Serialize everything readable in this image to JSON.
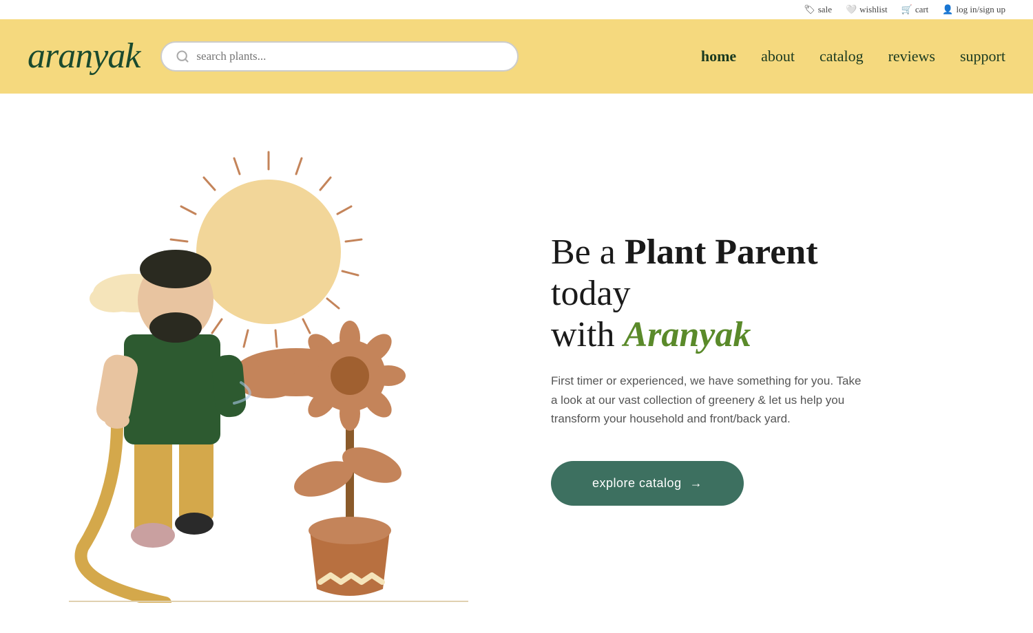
{
  "topbar": {
    "items": [
      {
        "id": "sale",
        "label": "sale",
        "icon": "tag"
      },
      {
        "id": "wishlist",
        "label": "wishlist",
        "icon": "heart"
      },
      {
        "id": "cart",
        "label": "cart",
        "icon": "cart"
      },
      {
        "id": "login",
        "label": "log in/sign up",
        "icon": "user"
      }
    ]
  },
  "header": {
    "logo": "aranyak",
    "search_placeholder": "search plants...",
    "nav": [
      {
        "id": "home",
        "label": "home",
        "active": true
      },
      {
        "id": "about",
        "label": "about",
        "active": false
      },
      {
        "id": "catalog",
        "label": "catalog",
        "active": false
      },
      {
        "id": "reviews",
        "label": "reviews",
        "active": false
      },
      {
        "id": "support",
        "label": "support",
        "active": false
      }
    ]
  },
  "hero": {
    "heading_part1": "Be a ",
    "heading_bold": "Plant Parent",
    "heading_part2": " today",
    "heading_line2_part1": "with ",
    "heading_brand": "Aranyak",
    "description": "First timer or experienced, we have something for you. Take a look at our vast collection of greenery & let us help you transform your household and front/back yard.",
    "cta_label": "explore catalog",
    "cta_arrow": "→"
  },
  "colors": {
    "header_bg": "#f5d97e",
    "brand_green": "#5a8a2a",
    "nav_dark": "#1a3a20",
    "button_bg": "#3d7060",
    "sun_color": "#f2d699",
    "cloud_color": "#f5e4ba",
    "cloud2_color": "#c4845a",
    "person_shirt": "#2d5a30",
    "person_pants": "#d4a84b",
    "person_skin": "#e8c4a0",
    "plant_color": "#c4845a",
    "pot_color": "#b87040"
  }
}
